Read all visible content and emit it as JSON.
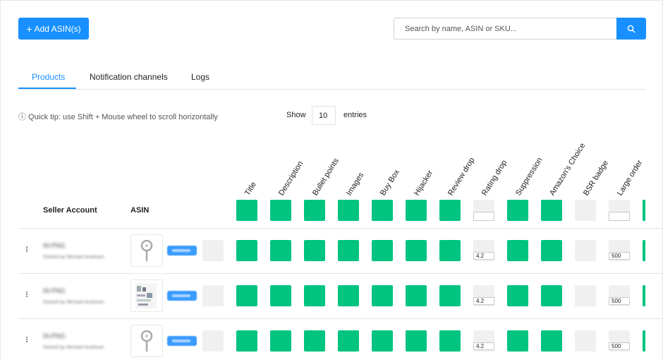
{
  "toolbar": {
    "add_label": "Add ASIN(s)"
  },
  "search": {
    "placeholder": "Search by name, ASIN or SKU..."
  },
  "tabs": [
    {
      "label": "Products",
      "active": true
    },
    {
      "label": "Notification channels",
      "active": false
    },
    {
      "label": "Logs",
      "active": false
    }
  ],
  "tip": "ⓘ Quick tip: use Shift + Mouse wheel to scroll horizontally",
  "pagination": {
    "show_label": "Show",
    "entries_value": "10",
    "entries_label": "entries"
  },
  "table": {
    "headers": {
      "seller": "Seller Account",
      "asin": "ASIN"
    },
    "columns": [
      "Title",
      "Description",
      "Bullet points",
      "Images",
      "Buy Box",
      "Hijacker",
      "Review drop",
      "Rating drop",
      "Suppression",
      "Amazon's Choice",
      "BSR badge",
      "Large order"
    ],
    "column_states": [
      "on",
      "on",
      "on",
      "on",
      "on",
      "on",
      "on",
      "input",
      "on",
      "on",
      "off",
      "input"
    ],
    "rows": [
      {
        "seller_name": "IN-PNG",
        "seller_sub": "Owned by Michael Andrews",
        "rating_drop": "4.2",
        "large_order": "500"
      },
      {
        "seller_name": "IN-PNG",
        "seller_sub": "Owned by Michael Andrews",
        "rating_drop": "4.2",
        "large_order": "500"
      },
      {
        "seller_name": "IN-PNG",
        "seller_sub": "Owned by Michael Andrews",
        "rating_drop": "4.2",
        "large_order": "500"
      }
    ]
  },
  "colors": {
    "accent": "#1890ff",
    "enabled": "#00c47f",
    "disabled": "#f0f0f0"
  }
}
